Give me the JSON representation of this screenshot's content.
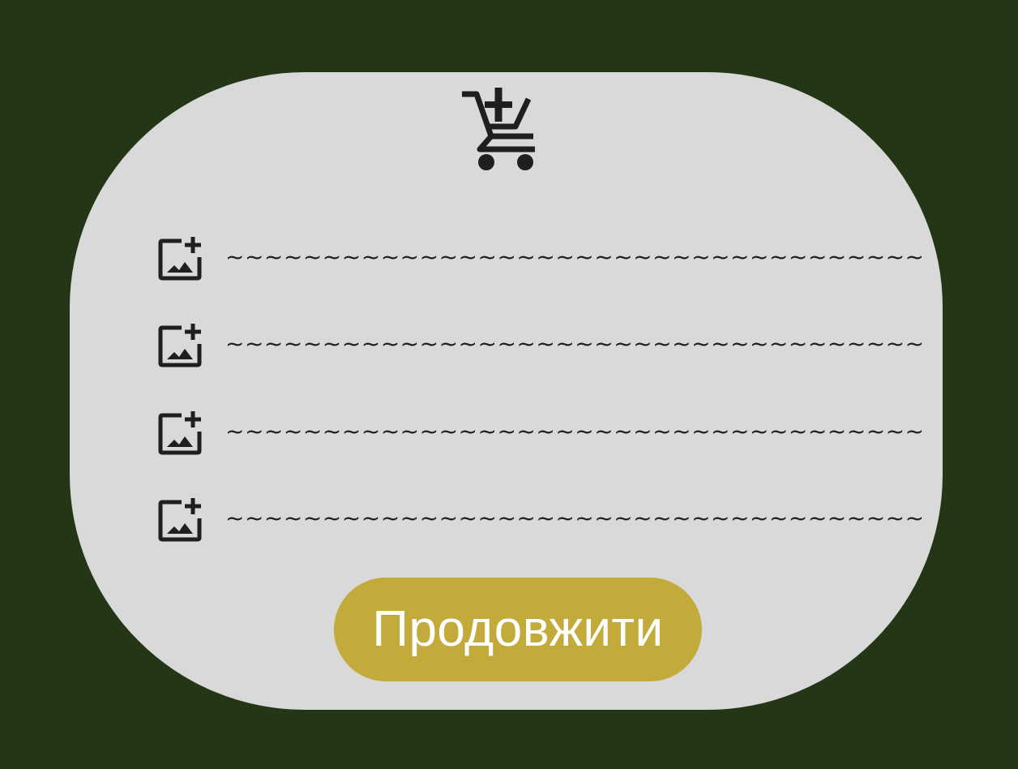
{
  "dialog": {
    "header_icon": "add-shopping-cart-icon",
    "items": [
      {
        "icon": "add-photo-icon",
        "text": "~~~~~~~~~~~~~~~~~~~~~~~~~~~~~~~~~~~~"
      },
      {
        "icon": "add-photo-icon",
        "text": "~~~~~~~~~~~~~~~~~~~~~~~~~~~~~~~~~~~~"
      },
      {
        "icon": "add-photo-icon",
        "text": "~~~~~~~~~~~~~~~~~~~~~~~~~~~~~~~~~~~~"
      },
      {
        "icon": "add-photo-icon",
        "text": "~~~~~~~~~~~~~~~~~~~~~~~~~~~~~~~~~~~~"
      }
    ],
    "continue_label": "Продовжити"
  },
  "colors": {
    "background": "#233616",
    "card": "#d9d9d9",
    "button": "#c2ab3b",
    "button_text": "#ffffff",
    "icon": "#1f1f1f"
  }
}
